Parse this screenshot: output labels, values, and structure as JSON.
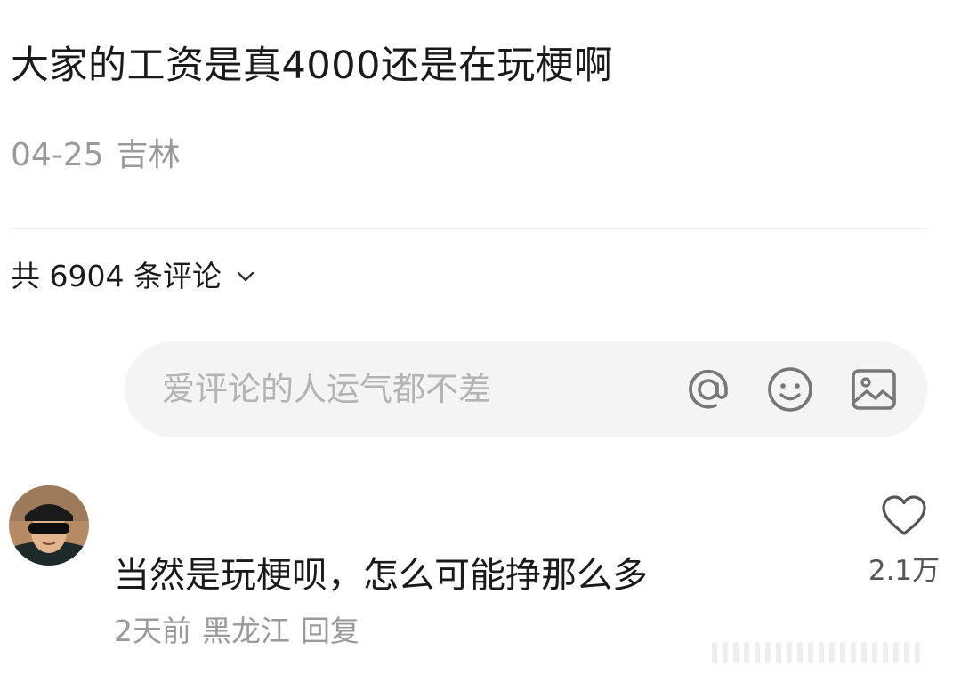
{
  "post": {
    "title": "大家的工资是真4000还是在玩梗啊",
    "date": "04-25",
    "location": "吉林"
  },
  "comments_section": {
    "count_label": "共 6904 条评论",
    "input_placeholder": "爱评论的人运气都不差",
    "icons": [
      "at-icon",
      "emoji-icon",
      "image-icon",
      "chevron-down-icon"
    ]
  },
  "comment": {
    "text": "当然是玩梗呗，怎么可能挣那么多",
    "time": "2天前",
    "location": "黑龙江",
    "reply_label": "回复",
    "likes": "2.1万"
  }
}
